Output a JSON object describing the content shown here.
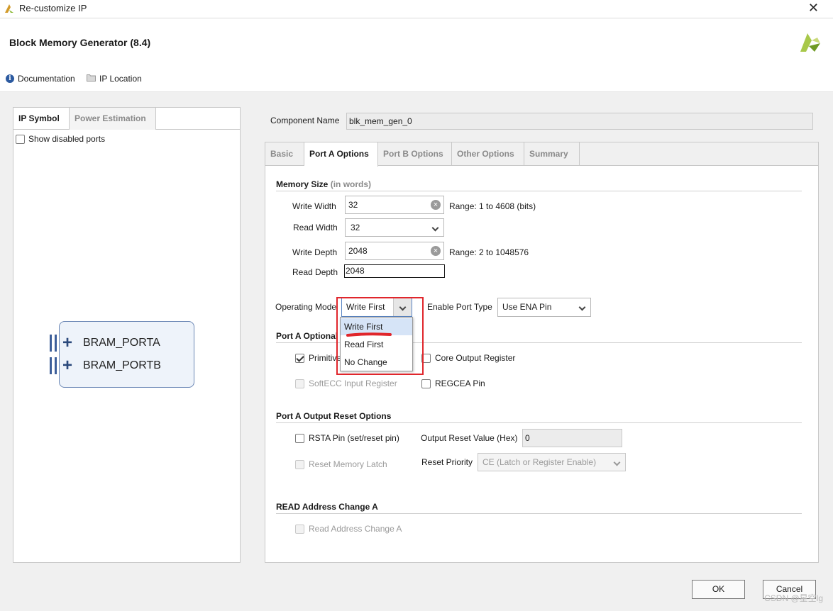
{
  "window": {
    "title": "Re-customize IP",
    "close_glyph": "✕"
  },
  "header": {
    "ip_name": "Block Memory Generator (8.4)",
    "documentation_label": "Documentation",
    "ip_location_label": "IP Location"
  },
  "left_panel": {
    "tabs": [
      {
        "label": "IP Symbol",
        "active": true
      },
      {
        "label": "Power Estimation",
        "active": false
      }
    ],
    "show_disabled_ports_label": "Show disabled ports",
    "show_disabled_ports_checked": false,
    "symbol": {
      "ports": [
        "BRAM_PORTA",
        "BRAM_PORTB"
      ],
      "plus_glyph": "+"
    }
  },
  "component": {
    "label": "Component Name",
    "value": "blk_mem_gen_0"
  },
  "tabs": [
    {
      "label": "Basic",
      "active": false
    },
    {
      "label": "Port A Options",
      "active": true
    },
    {
      "label": "Port B Options",
      "active": false
    },
    {
      "label": "Other Options",
      "active": false
    },
    {
      "label": "Summary",
      "active": false
    }
  ],
  "memory_size": {
    "title": "Memory Size",
    "title_suffix": "(in words)",
    "write_width": {
      "label": "Write Width",
      "value": "32",
      "range": "Range: 1 to 4608 (bits)"
    },
    "read_width": {
      "label": "Read Width",
      "value": "32"
    },
    "write_depth": {
      "label": "Write Depth",
      "value": "2048",
      "range": "Range: 2 to 1048576"
    },
    "read_depth": {
      "label": "Read Depth",
      "value": "2048"
    }
  },
  "operating_mode": {
    "label": "Operating Mode",
    "value": "Write First",
    "options": [
      "Write First",
      "Read First",
      "No Change"
    ],
    "highlighted_option": "Write First"
  },
  "enable_port_type": {
    "label": "Enable Port Type",
    "value": "Use ENA Pin"
  },
  "optional_output_registers": {
    "title": "Port A Optional O",
    "primitives_label": "Primitive",
    "primitives_checked": true,
    "core_output_register_label": "Core Output Register",
    "core_output_register_checked": false,
    "softecc_label": "SoftECC Input Register",
    "regcea_label": "REGCEA Pin"
  },
  "output_reset": {
    "title": "Port A Output Reset Options",
    "rsta_label": "RSTA Pin (set/reset pin)",
    "output_reset_value_label": "Output Reset Value (Hex)",
    "output_reset_value": "0",
    "reset_memory_latch_label": "Reset Memory Latch",
    "reset_priority_label": "Reset Priority",
    "reset_priority_value": "CE (Latch or Register Enable)"
  },
  "read_address_change": {
    "title": "READ Address Change A",
    "checkbox_label": "Read Address Change A"
  },
  "footer": {
    "ok_label": "OK",
    "cancel_label": "Cancel",
    "watermark": "CSDN @星空lg"
  },
  "colors": {
    "accent_red": "#e0262c",
    "selection_blue": "#d6e4f7",
    "brand_green": "#8ab833"
  },
  "icons": {
    "title_logo": "xilinx-logo-icon",
    "brand_logo": "xilinx-logo-icon",
    "documentation": "info-icon",
    "ip_location": "folder-icon",
    "clear": "clear-icon",
    "dropdown": "chevron-down-icon"
  }
}
